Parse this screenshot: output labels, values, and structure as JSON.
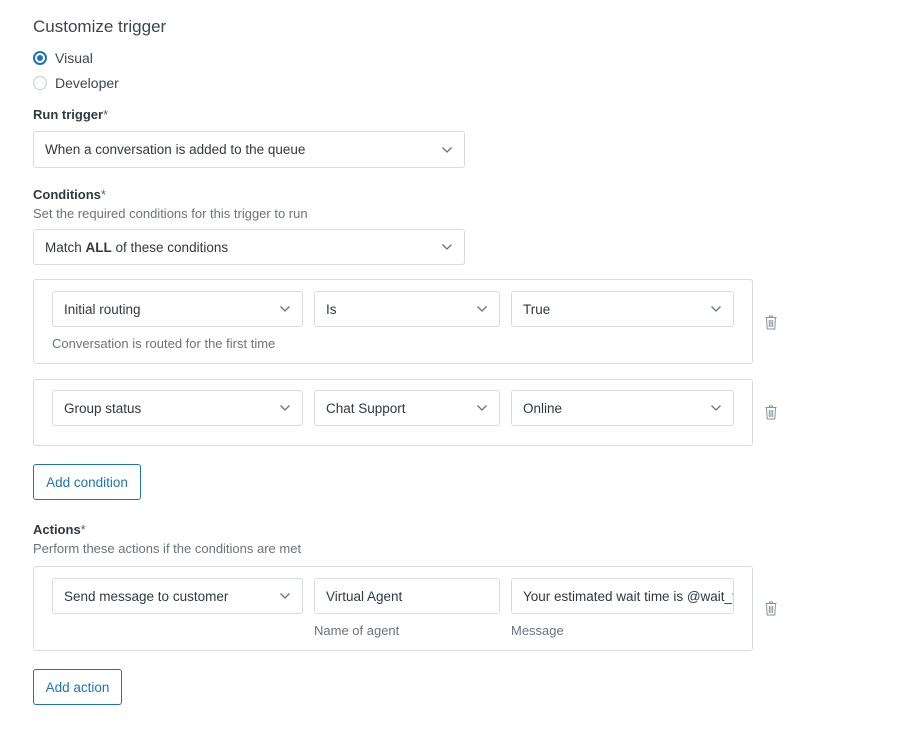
{
  "page": {
    "title": "Customize trigger"
  },
  "mode": {
    "options": [
      {
        "label": "Visual",
        "selected": true
      },
      {
        "label": "Developer",
        "selected": false
      }
    ]
  },
  "run_trigger": {
    "label": "Run trigger",
    "required_mark": "*",
    "value": "When a conversation is added to the queue"
  },
  "conditions": {
    "label": "Conditions",
    "required_mark": "*",
    "hint": "Set the required conditions for this trigger to run",
    "match_prefix": "Match ",
    "match_bold": "ALL",
    "match_suffix": " of these conditions",
    "rows": [
      {
        "field": "Initial routing",
        "operator": "Is",
        "value": "True",
        "description": "Conversation is routed for the first time"
      },
      {
        "field": "Group status",
        "operator": "Chat Support",
        "value": "Online"
      }
    ],
    "add_label": "Add condition"
  },
  "actions": {
    "label": "Actions",
    "required_mark": "*",
    "hint": "Perform these actions if the conditions are met",
    "rows": [
      {
        "action": "Send message to customer",
        "agent_name": "Virtual Agent",
        "agent_name_caption": "Name of agent",
        "message": "Your estimated wait time is @wait_ti",
        "message_caption": "Message"
      }
    ],
    "add_label": "Add action"
  },
  "icons": {
    "dropdown": "chevron-down-icon",
    "delete": "trash-icon"
  },
  "colors": {
    "accent": "#1f73b7",
    "border": "#d8dcde",
    "text": "#2f3941",
    "muted": "#68737d"
  }
}
